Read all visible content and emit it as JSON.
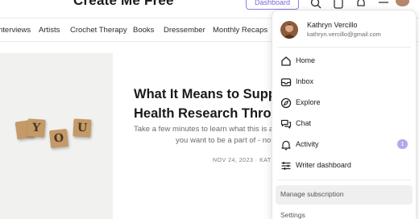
{
  "header": {
    "site_title": "Create Me Free",
    "dashboard_label": "Dashboard"
  },
  "nav": {
    "items": [
      "nterviews",
      "Artists",
      "Crochet Therapy",
      "Books",
      "Dressember",
      "Monthly Recaps"
    ]
  },
  "hero": {
    "title_line1": "What It Means to Supp",
    "title_line2": "Health Research Throu",
    "subtitle_line1": "Take a few minutes to learn what this is all",
    "subtitle_line2": "you want to be a part of - no",
    "meta": "NOV 24, 2023 · KATHR",
    "blocks": [
      "Y",
      "O",
      "U"
    ]
  },
  "dropdown": {
    "user": {
      "name": "Kathryn Vercillo",
      "email": "kathryn.vercillo@gmail.com"
    },
    "items": [
      {
        "label": "Home",
        "icon": "home-icon"
      },
      {
        "label": "Inbox",
        "icon": "inbox-icon"
      },
      {
        "label": "Explore",
        "icon": "compass-icon"
      },
      {
        "label": "Chat",
        "icon": "chat-icon"
      },
      {
        "label": "Activity",
        "icon": "bell-icon",
        "badge": "1"
      },
      {
        "label": "Writer dashboard",
        "icon": "sliders-icon"
      }
    ],
    "manage_subscription": "Manage subscription",
    "settings": "Settings"
  },
  "colors": {
    "accent": "#7a68d8",
    "badge": "#b6a6ef",
    "hover": "#efefef"
  }
}
